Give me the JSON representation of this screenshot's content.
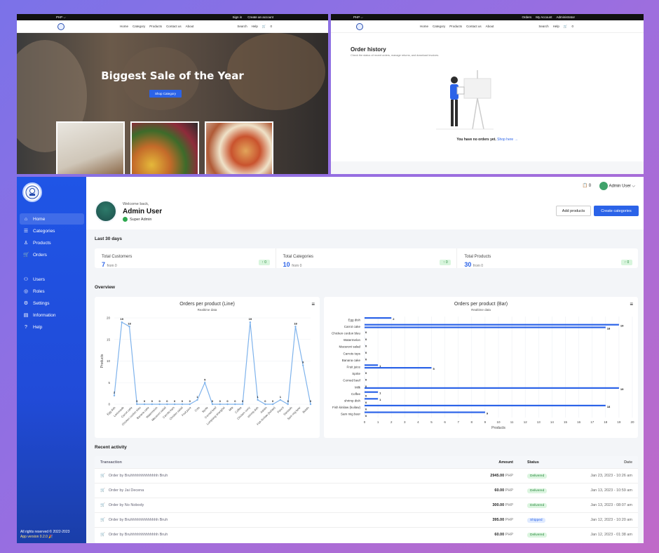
{
  "store": {
    "currency": "PHP ⌵",
    "signin": "Sign in",
    "create_account": "Create an account",
    "nav": [
      "Home",
      "Category",
      "Products",
      "Contact us",
      "About"
    ],
    "search": "Search",
    "help": "Help",
    "cart_count": "0",
    "hero_title": "Biggest Sale of the Year",
    "hero_button": "Shop Category"
  },
  "orders_page": {
    "currency": "PHP ⌵",
    "top_links": [
      "Orders",
      "My Account",
      "Administrator"
    ],
    "nav": [
      "Home",
      "Category",
      "Products",
      "Contact us",
      "About"
    ],
    "search": "Search",
    "help": "Help",
    "cart_count": "0",
    "title": "Order history",
    "subtitle": "Check the status of recent orders, manage returns, and download invoices.",
    "empty_text": "You have no orders yet.",
    "empty_link": "Shop here →"
  },
  "admin": {
    "sidebar": {
      "items": [
        {
          "label": "Home",
          "icon": "home-icon",
          "glyph": "⌂"
        },
        {
          "label": "Categories",
          "icon": "list-icon",
          "glyph": "☰"
        },
        {
          "label": "Products",
          "icon": "box-icon",
          "glyph": "♙"
        },
        {
          "label": "Orders",
          "icon": "cart-icon",
          "glyph": "🛒"
        },
        {
          "label": "Users",
          "icon": "users-icon",
          "glyph": "⚇"
        },
        {
          "label": "Roles",
          "icon": "roles-icon",
          "glyph": "◎"
        },
        {
          "label": "Settings",
          "icon": "gear-icon",
          "glyph": "⚙"
        },
        {
          "label": "Information",
          "icon": "info-icon",
          "glyph": "▤"
        },
        {
          "label": "Help",
          "icon": "help-icon",
          "glyph": "?"
        }
      ],
      "footer_rights": "All rights reserved © 2022-2023",
      "footer_version": "App version 0.2.0"
    },
    "header": {
      "notif_count": "0",
      "user_menu": "Admin User ⌵"
    },
    "welcome": {
      "greeting": "Welcome back,",
      "name": "Admin User",
      "role": "Super Admin",
      "add_products": "Add products",
      "create_categories": "Create categories"
    },
    "section_last30": "Last 30 days",
    "stats": [
      {
        "title": "Total Customers",
        "value": "7",
        "from": "from 0",
        "badge": "↑ 0"
      },
      {
        "title": "Total Categories",
        "value": "10",
        "from": "from 0",
        "badge": "↑ 0"
      },
      {
        "title": "Total Products",
        "value": "30",
        "from": "from 0",
        "badge": "↑ 0"
      }
    ],
    "section_overview": "Overview",
    "section_recent": "Recent activity",
    "table": {
      "headers": [
        "Transaction",
        "Amount",
        "Status",
        "Date"
      ],
      "rows": [
        {
          "tx": "Order by Bruhhhhhhhhhhhhh Bruh",
          "amount": "2945.00",
          "currency": "PHP",
          "status": "Delivered",
          "date": "Jan 23, 2023 - 10:26 am"
        },
        {
          "tx": "Order by Jai Decena",
          "amount": "60.00",
          "currency": "PHP",
          "status": "Delivered",
          "date": "Jan 13, 2023 - 10:59 am"
        },
        {
          "tx": "Order by No Nobody",
          "amount": "300.00",
          "currency": "PHP",
          "status": "Delivered",
          "date": "Jan 13, 2023 - 08:07 am"
        },
        {
          "tx": "Order by Bruhhhhhhhhhhhhh Bruh",
          "amount": "395.00",
          "currency": "PHP",
          "status": "Shipped",
          "date": "Jan 12, 2023 - 10:20 am"
        },
        {
          "tx": "Order by Bruhhhhhhhhhhhhh Bruh",
          "amount": "60.00",
          "currency": "PHP",
          "status": "Delivered",
          "date": "Jan 12, 2023 - 01:38 am"
        }
      ]
    },
    "colors": {
      "primary": "#2b63e8",
      "sidebar": "#1f55e6",
      "success": "#2a8a3f",
      "line": "#7fb3ec"
    }
  },
  "chart_data": [
    {
      "type": "line",
      "title": "Orders per product (Line)",
      "subtitle": "Realtime data",
      "ylabel": "Products",
      "ylim": [
        0,
        20
      ],
      "yticks": [
        0,
        5,
        10,
        15,
        20
      ],
      "categories": [
        "Egg dish",
        "Lemonade",
        "Carrot cake",
        "Chicken cordon bleu",
        "Banana cake",
        "Watermelon",
        "Macaroni salad",
        "Carrots tops",
        "Chicken salad",
        "Fruit juice",
        "Cola",
        "Sprite",
        "Corned beef",
        "Lumpiang shanghai",
        "Milk",
        "Coffee",
        "Chicken curry",
        "shrimp dish",
        "Adobo",
        "Dinuguan",
        "Fish kinilaw (kuilaw)",
        "Pancit",
        "Sarsiado",
        "Shrimp fish",
        "Sisig",
        "Sam mig beer",
        "Bulalo"
      ],
      "values": [
        2,
        19,
        18,
        0,
        0,
        0,
        0,
        0,
        0,
        0,
        0,
        1,
        5,
        0,
        0,
        0,
        0,
        0,
        19,
        1,
        0,
        0,
        1,
        0,
        18,
        9,
        0
      ],
      "x_tick_labels": [
        "Egg dish",
        "Lemonade",
        "Carrot cake",
        "Chicken cordon bleu",
        "Banana cake",
        "Watermelon",
        "Macaroni salad",
        "Carrots tops",
        "Chicken salad",
        "Fruit juice",
        "Cola",
        "Sprite",
        "Corned beef",
        "Lumpiang shanghai",
        "Milk",
        "Coffee",
        "Chicken curry",
        "shrimp dish",
        "Adobo",
        "Fish kinilaw (kuilaw)",
        "Pancit",
        "Sarsiado",
        "Sam mig beer",
        "Bulalo"
      ]
    },
    {
      "type": "bar",
      "orientation": "horizontal",
      "title": "Orders per product (Bar)",
      "subtitle": "Realtime data",
      "xlabel": "Products",
      "xlim": [
        0,
        20
      ],
      "xticks": [
        0,
        1,
        2,
        3,
        4,
        5,
        6,
        7,
        8,
        9,
        10,
        11,
        12,
        13,
        14,
        15,
        16,
        17,
        18,
        19,
        20
      ],
      "categories": [
        "Egg dish",
        "Carrot cake",
        "Chicken cordon bleu",
        "Watermelon",
        "Macaroni salad",
        "Carrots tops",
        "Banana cake",
        "Fruit juice",
        "Sprite",
        "Corned beef",
        "Milk",
        "Coffee",
        "shrimp dish",
        "Fish kinilaw (kuilaw)",
        "Sam mig beer"
      ],
      "rows": [
        {
          "label": "Egg dish",
          "bars": [
            2
          ]
        },
        {
          "label": "Carrot cake",
          "bars": [
            19,
            18
          ]
        },
        {
          "label": "Chicken cordon bleu",
          "bars": [
            0
          ]
        },
        {
          "label": "Watermelon",
          "bars": [
            0
          ]
        },
        {
          "label": "Macaroni salad",
          "bars": [
            0
          ]
        },
        {
          "label": "Carrots tops",
          "bars": [
            0
          ]
        },
        {
          "label": "Banana cake",
          "bars": [
            0
          ]
        },
        {
          "label": "Fruit juice",
          "bars": [
            1,
            5
          ]
        },
        {
          "label": "Sprite",
          "bars": [
            0
          ]
        },
        {
          "label": "Corned beef",
          "bars": [
            0
          ]
        },
        {
          "label": "Milk",
          "bars": [
            0,
            19
          ]
        },
        {
          "label": "Coffee",
          "bars": [
            1,
            0
          ]
        },
        {
          "label": "shrimp dish",
          "bars": [
            1,
            0
          ]
        },
        {
          "label": "Fish kinilaw (kuilaw)",
          "bars": [
            18,
            0
          ]
        },
        {
          "label": "Sam mig beer",
          "bars": [
            9,
            0
          ]
        }
      ]
    }
  ]
}
